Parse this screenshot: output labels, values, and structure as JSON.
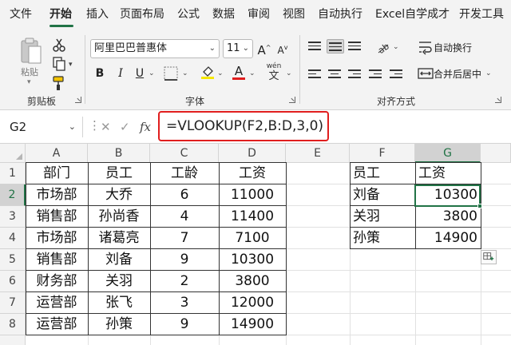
{
  "tabs": [
    "文件",
    "开始",
    "插入",
    "页面布局",
    "公式",
    "数据",
    "审阅",
    "视图",
    "自动执行",
    "Excel自学成才",
    "开发工具"
  ],
  "active_tab": "开始",
  "clipboard": {
    "paste_label": "粘贴",
    "group_label": "剪贴板"
  },
  "font": {
    "name": "阿里巴巴普惠体",
    "size": "11",
    "bold": "B",
    "italic": "I",
    "underline": "U",
    "wen": "wén",
    "wen_char": "文",
    "font_color_letter": "A",
    "group_label": "字体",
    "grow": "A",
    "shrink": "A"
  },
  "alignment": {
    "wrap_label": "自动换行",
    "merge_label": "合并后居中",
    "group_label": "对齐方式"
  },
  "formula_bar": {
    "name_box": "G2",
    "formula": "=VLOOKUP(F2,B:D,3,0)",
    "fx": "fx"
  },
  "columns": [
    "A",
    "B",
    "C",
    "D",
    "E",
    "F",
    "G"
  ],
  "rows": [
    "1",
    "2",
    "3",
    "4",
    "5",
    "6",
    "7",
    "8"
  ],
  "active_cell": {
    "col": "G",
    "row": "2"
  },
  "source_table": {
    "headers": [
      "部门",
      "员工",
      "工龄",
      "工资"
    ],
    "rows": [
      [
        "市场部",
        "大乔",
        "6",
        "11000"
      ],
      [
        "销售部",
        "孙尚香",
        "4",
        "11400"
      ],
      [
        "市场部",
        "诸葛亮",
        "7",
        "7100"
      ],
      [
        "销售部",
        "刘备",
        "9",
        "10300"
      ],
      [
        "财务部",
        "关羽",
        "2",
        "3800"
      ],
      [
        "运营部",
        "张飞",
        "3",
        "12000"
      ],
      [
        "运营部",
        "孙策",
        "9",
        "14900"
      ]
    ]
  },
  "lookup_table": {
    "headers": [
      "员工",
      "工资"
    ],
    "rows": [
      [
        "刘备",
        "10300"
      ],
      [
        "关羽",
        "3800"
      ],
      [
        "孙策",
        "14900"
      ]
    ]
  },
  "colors": {
    "accent": "#217346",
    "highlight_border": "#e01e1e",
    "ribbon_bg": "#f3f3f3"
  }
}
